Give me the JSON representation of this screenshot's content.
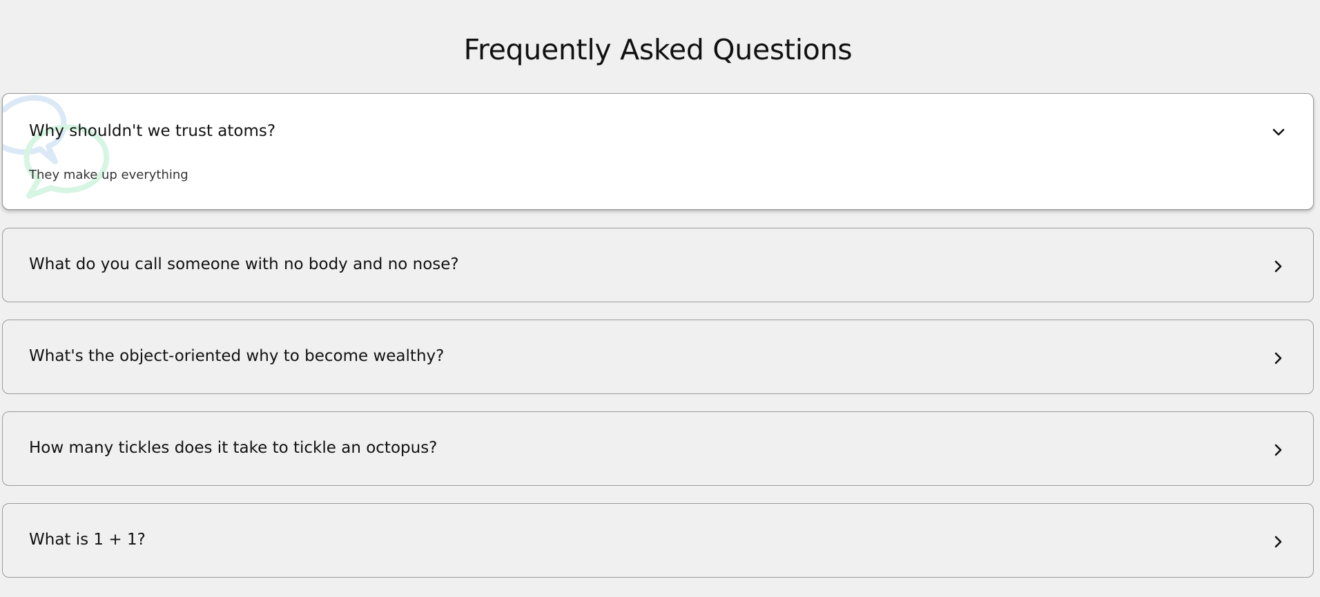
{
  "page": {
    "title": "Frequently Asked Questions"
  },
  "faq": {
    "items": [
      {
        "question": "Why shouldn't we trust atoms?",
        "answer": "They make up everything",
        "expanded": true
      },
      {
        "question": "What do you call someone with no body and no nose?",
        "expanded": false
      },
      {
        "question": "What's the object-oriented why to become wealthy?",
        "expanded": false
      },
      {
        "question": "How many tickles does it take to tickle an octopus?",
        "expanded": false
      },
      {
        "question": "What is 1 + 1?",
        "expanded": false
      }
    ]
  },
  "icons": {
    "expanded_toggle": "chevron-down-icon",
    "collapsed_toggle": "chevron-right-icon",
    "decoration": "speech-bubbles-icon"
  },
  "colors": {
    "background": "#f0f0f0",
    "active_card": "#ffffff",
    "border": "#9a9a9a",
    "bubble_blue": "#dbe9f7",
    "bubble_green": "#d7f5e3"
  }
}
